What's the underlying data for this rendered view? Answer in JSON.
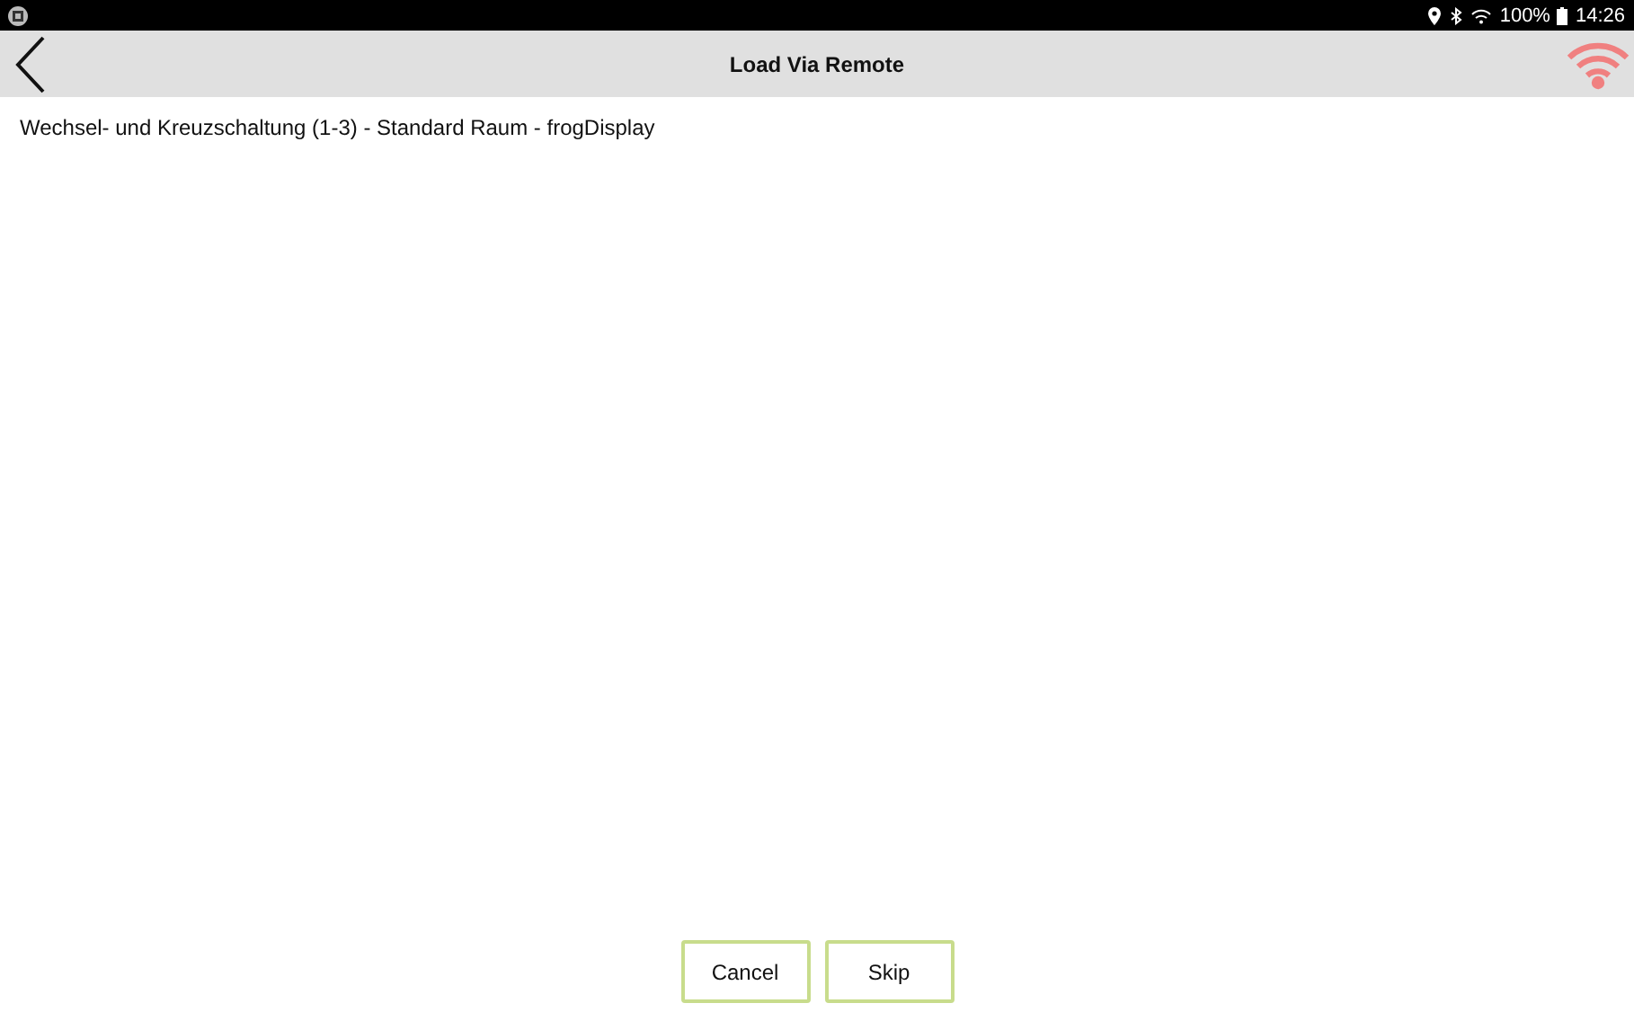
{
  "status_bar": {
    "battery": "100%",
    "time": "14:26"
  },
  "header": {
    "title": "Load Via Remote"
  },
  "content": {
    "text": "Wechsel- und Kreuzschaltung (1-3) - Standard Raum - frogDisplay"
  },
  "buttons": [
    {
      "label": "Cancel"
    },
    {
      "label": "Skip"
    }
  ]
}
